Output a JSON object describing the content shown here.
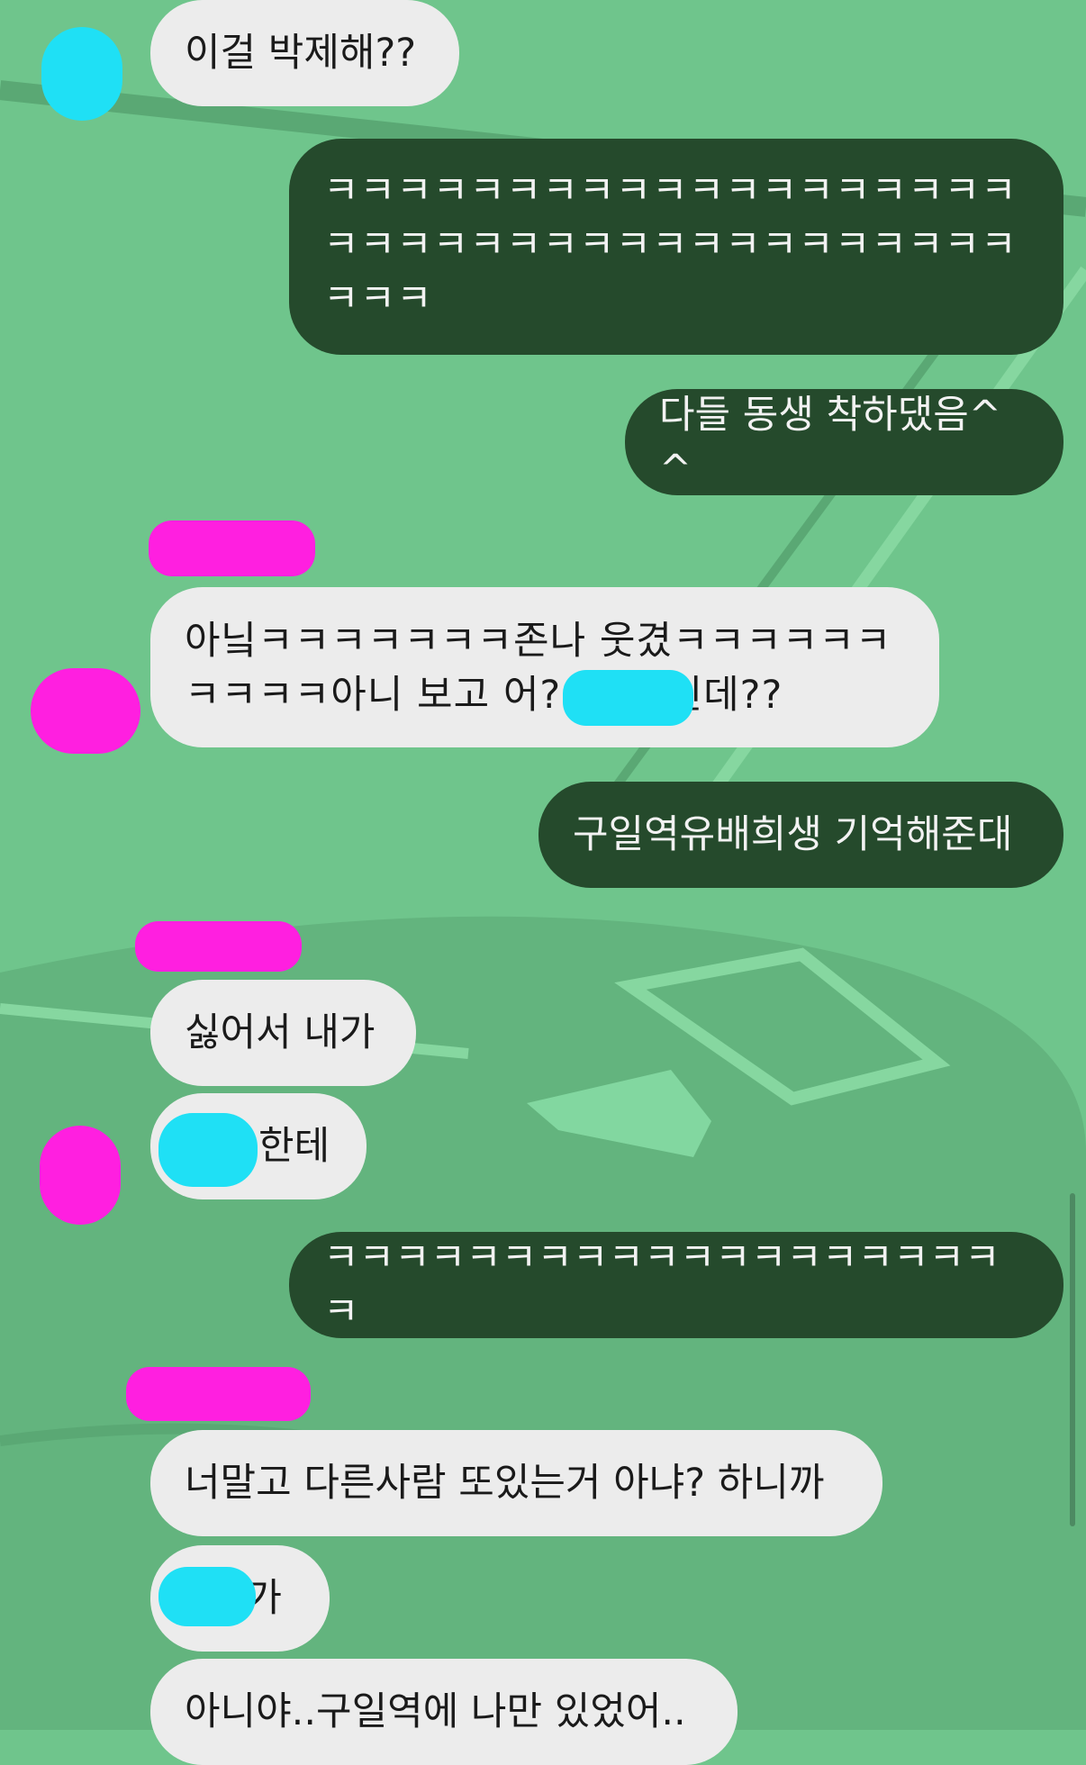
{
  "colors": {
    "background": "#6fc58c",
    "incoming_bubble": "#ececec",
    "outgoing_bubble": "#254a2c",
    "censor_cyan": "#1fe0f5",
    "censor_pink": "#ff1fe0"
  },
  "messages": [
    {
      "side": "incoming",
      "text": "이걸 박제해??"
    },
    {
      "side": "outgoing",
      "text": "ㅋㅋㅋㅋㅋㅋㅋㅋㅋㅋㅋㅋㅋㅋㅋㅋㅋㅋㅋㅋㅋㅋㅋㅋㅋㅋㅋㅋㅋㅋㅋㅋㅋㅋㅋㅋㅋㅋㅋㅋㅋ"
    },
    {
      "side": "outgoing",
      "text": "다들 동생 착하댔음^^"
    },
    {
      "side": "incoming",
      "text": "아닠ㅋㅋㅋㅋㅋㅋㅋ존나 웃겼ㅋㅋㅋㅋㅋㅋㅋㅋㅋㅋ아니 보고 어?        인데??"
    },
    {
      "side": "outgoing",
      "text": "구일역유배희생 기억해준대"
    },
    {
      "side": "incoming",
      "text": "싫어서 내가"
    },
    {
      "side": "incoming",
      "text": "      한테"
    },
    {
      "side": "outgoing",
      "text": "ㅋㅋㅋㅋㅋㅋㅋㅋㅋㅋㅋㅋㅋㅋㅋㅋㅋㅋㅋㅋ"
    },
    {
      "side": "incoming",
      "text": "너말고 다른사람 또있는거 아냐? 하니까"
    },
    {
      "side": "incoming",
      "text": "     가"
    },
    {
      "side": "incoming",
      "text": "아니야..구일역에 나만 있었어.."
    }
  ]
}
